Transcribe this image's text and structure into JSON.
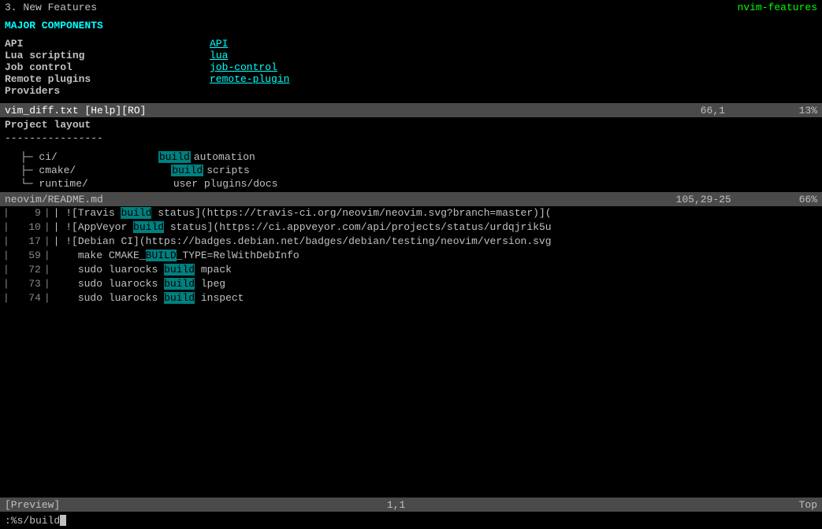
{
  "top_pane": {
    "header": {
      "left": "3. New Features",
      "right": "nvim-features"
    },
    "section_heading": "MAJOR COMPONENTS",
    "features": [
      {
        "label": "API",
        "link": "API",
        "has_link": true
      },
      {
        "label": "Lua scripting",
        "link": "lua",
        "has_link": true
      },
      {
        "label": "Job control",
        "link": "job-control",
        "has_link": true
      },
      {
        "label": "Remote plugins",
        "link": "remote-plugin",
        "has_link": true
      },
      {
        "label": "Providers",
        "link": "",
        "has_link": false
      }
    ],
    "statusline": {
      "left": "vim_diff.txt [Help][RO]",
      "pos": "66,1",
      "pct": "13%"
    }
  },
  "middle_pane": {
    "project_layout_label": "Project layout",
    "divider": "----------------",
    "tree_items": [
      {
        "branch": "├─ ci/",
        "tag": "build",
        "desc": "automation"
      },
      {
        "branch": "├─ cmake/",
        "tag": "build",
        "desc": "scripts"
      },
      {
        "branch": "└─ runtime/",
        "tag": "",
        "desc": "user plugins/docs"
      }
    ],
    "statusline": {
      "left": "neovim/README.md",
      "pos": "105,29-25",
      "pct": "66%"
    }
  },
  "diff_pane": {
    "lines": [
      {
        "num": "9",
        "content_before": "| ![Travis ",
        "highlight": "build",
        "content_after": " status](https://travis-ci.org/neovim/neovim.svg?branch=master)]("
      },
      {
        "num": "10",
        "content_before": "| ![AppVeyor ",
        "highlight": "build",
        "content_after": " status](https://ci.appveyor.com/api/projects/status/urdqjrik5u"
      },
      {
        "num": "17",
        "content_before": "| ![Debian CI](https://badges.debian.net/badges/debian/testing/neovim/version.svg",
        "highlight": "",
        "content_after": ""
      },
      {
        "num": "59",
        "content_before": "    make CMAKE_",
        "highlight": "BUILD",
        "content_after": "_TYPE=RelWithDebInfo"
      },
      {
        "num": "72",
        "content_before": "    sudo luarocks ",
        "highlight": "build",
        "content_after": " mpack"
      },
      {
        "num": "73",
        "content_before": "    sudo luarocks ",
        "highlight": "build",
        "content_after": " lpeg"
      },
      {
        "num": "74",
        "content_before": "    sudo luarocks ",
        "highlight": "build",
        "content_after": " inspect"
      }
    ]
  },
  "preview_statusline": {
    "left": "[Preview]",
    "pos": "1,1",
    "right": "Top"
  },
  "cmdline": {
    "text": ":%s/build"
  }
}
